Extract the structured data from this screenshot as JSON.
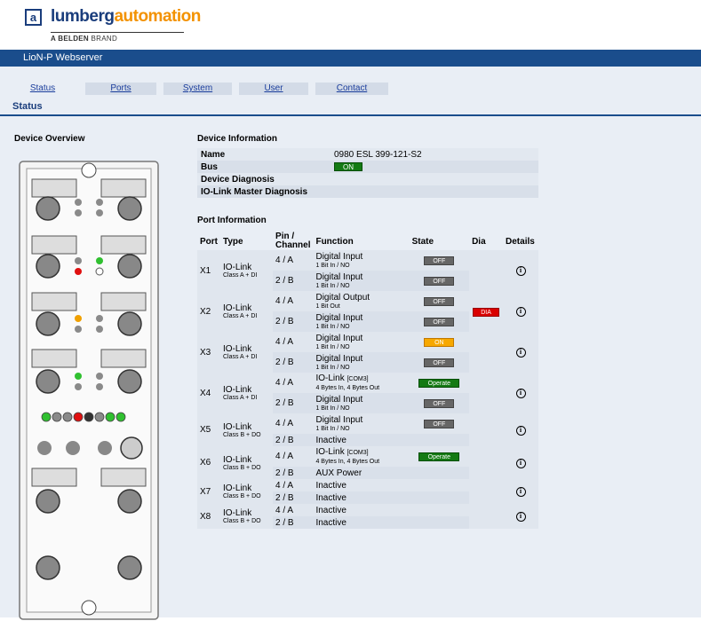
{
  "header": {
    "logo_letter": "a",
    "logo_part1": "lumberg",
    "logo_part2": "automation",
    "brand_bold": "A BELDEN",
    "brand_rest": "BRAND",
    "title": "LioN-P Webserver"
  },
  "tabs": [
    {
      "label": "Status",
      "active": true
    },
    {
      "label": "Ports",
      "active": false
    },
    {
      "label": "System",
      "active": false
    },
    {
      "label": "User",
      "active": false
    },
    {
      "label": "Contact",
      "active": false
    }
  ],
  "section_title": "Status",
  "device_overview_label": "Device Overview",
  "device_info": {
    "heading": "Device Information",
    "rows": [
      {
        "label": "Name",
        "value": "0980 ESL 399-121-S2"
      },
      {
        "label": "Bus",
        "badge": "ON"
      },
      {
        "label": "Device Diagnosis",
        "value": ""
      },
      {
        "label": "IO-Link Master Diagnosis",
        "value": ""
      }
    ]
  },
  "port_info": {
    "heading": "Port Information",
    "columns": {
      "port": "Port",
      "type": "Type",
      "pin": "Pin / Channel",
      "function": "Function",
      "state": "State",
      "dia": "Dia",
      "details": "Details"
    },
    "ports": [
      {
        "port": "X1",
        "type": "IO-Link",
        "type_sub": "Class A + DI",
        "dia": "",
        "rows": [
          {
            "pin": "4 / A",
            "func": "Digital Input",
            "func_sub": "1 Bit In / NO",
            "state": "OFF"
          },
          {
            "pin": "2 / B",
            "func": "Digital Input",
            "func_sub": "1 Bit In / NO",
            "state": "OFF"
          }
        ]
      },
      {
        "port": "X2",
        "type": "IO-Link",
        "type_sub": "Class A + DI",
        "dia": "DIA",
        "rows": [
          {
            "pin": "4 / A",
            "func": "Digital Output",
            "func_sub": "1 Bit Out",
            "state": "OFF"
          },
          {
            "pin": "2 / B",
            "func": "Digital Input",
            "func_sub": "1 Bit In / NO",
            "state": "OFF"
          }
        ]
      },
      {
        "port": "X3",
        "type": "IO-Link",
        "type_sub": "Class A + DI",
        "dia": "",
        "rows": [
          {
            "pin": "4 / A",
            "func": "Digital Input",
            "func_sub": "1 Bit In / NO",
            "state": "ON"
          },
          {
            "pin": "2 / B",
            "func": "Digital Input",
            "func_sub": "1 Bit In / NO",
            "state": "OFF"
          }
        ]
      },
      {
        "port": "X4",
        "type": "IO-Link",
        "type_sub": "Class A + DI",
        "dia": "",
        "rows": [
          {
            "pin": "4 / A",
            "func": "IO-Link",
            "func_tag": "[COM3]",
            "func_sub": "4 Bytes In, 4 Bytes Out",
            "state": "Operate"
          },
          {
            "pin": "2 / B",
            "func": "Digital Input",
            "func_sub": "1 Bit In / NO",
            "state": "OFF"
          }
        ]
      },
      {
        "port": "X5",
        "type": "IO-Link",
        "type_sub": "Class B + DO",
        "dia": "",
        "rows": [
          {
            "pin": "4 / A",
            "func": "Digital Input",
            "func_sub": "1 Bit In / NO",
            "state": "OFF"
          },
          {
            "pin": "2 / B",
            "func": "Inactive",
            "func_sub": "",
            "state": ""
          }
        ]
      },
      {
        "port": "X6",
        "type": "IO-Link",
        "type_sub": "Class B + DO",
        "dia": "",
        "rows": [
          {
            "pin": "4 / A",
            "func": "IO-Link",
            "func_tag": "[COM3]",
            "func_sub": "4 Bytes In, 4 Bytes Out",
            "state": "Operate"
          },
          {
            "pin": "2 / B",
            "func": "AUX Power",
            "func_sub": "",
            "state": ""
          }
        ]
      },
      {
        "port": "X7",
        "type": "IO-Link",
        "type_sub": "Class B + DO",
        "dia": "",
        "rows": [
          {
            "pin": "4 / A",
            "func": "Inactive",
            "func_sub": "",
            "state": ""
          },
          {
            "pin": "2 / B",
            "func": "Inactive",
            "func_sub": "",
            "state": ""
          }
        ]
      },
      {
        "port": "X8",
        "type": "IO-Link",
        "type_sub": "Class B + DO",
        "dia": "",
        "rows": [
          {
            "pin": "4 / A",
            "func": "Inactive",
            "func_sub": "",
            "state": ""
          },
          {
            "pin": "2 / B",
            "func": "Inactive",
            "func_sub": "",
            "state": ""
          }
        ]
      }
    ]
  },
  "colors": {
    "brand_blue": "#1a4d8c",
    "orange": "#f39200",
    "status_green": "#147a14",
    "status_off": "#666666",
    "status_on": "#f7a800",
    "dia_red": "#d90000"
  },
  "icons": {
    "details": "info-icon"
  }
}
